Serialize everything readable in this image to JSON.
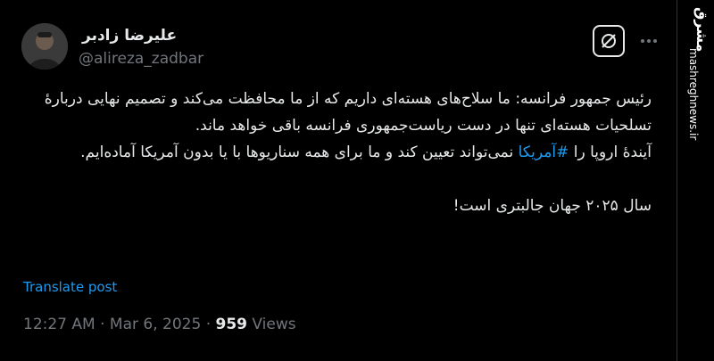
{
  "user": {
    "display_name": "علیرضا زادبر",
    "handle": "@alireza_zadbar"
  },
  "tweet": {
    "line1_before": "",
    "paragraph1": "رئیس جمهور فرانسه: ما سلاح‌های هسته‌ای داریم که از ما محافظت می‌کند و تصمیم نهایی دربارهٔ تسلحیات هسته‌ای تنها در دست ریاست‌جمهوری فرانسه باقی خواهد ماند.",
    "paragraph2_start": "آیندهٔ اروپا را ",
    "hashtag": "#آمریکا",
    "paragraph2_end": " نمی‌تواند تعیین کند و ما برای همه سناریوها با یا بدون آمریکا آماده‌ایم.",
    "paragraph3": "سال ۲۰۲۵ جهان جالبتری است!"
  },
  "actions": {
    "translate_label": "Translate post"
  },
  "meta": {
    "time": "12:27 AM",
    "separator": "·",
    "date": "Mar 6, 2025",
    "views_count": "959",
    "views_label": "Views"
  },
  "watermark": {
    "logo_text": "مشرق",
    "url_text": "mashreghnews.ir"
  },
  "icons": {
    "grok": "grok-icon",
    "more": "more-icon"
  },
  "colors": {
    "background": "#000000",
    "text": "#e7e9ea",
    "secondary": "#71767b",
    "link": "#1d9bf0"
  }
}
